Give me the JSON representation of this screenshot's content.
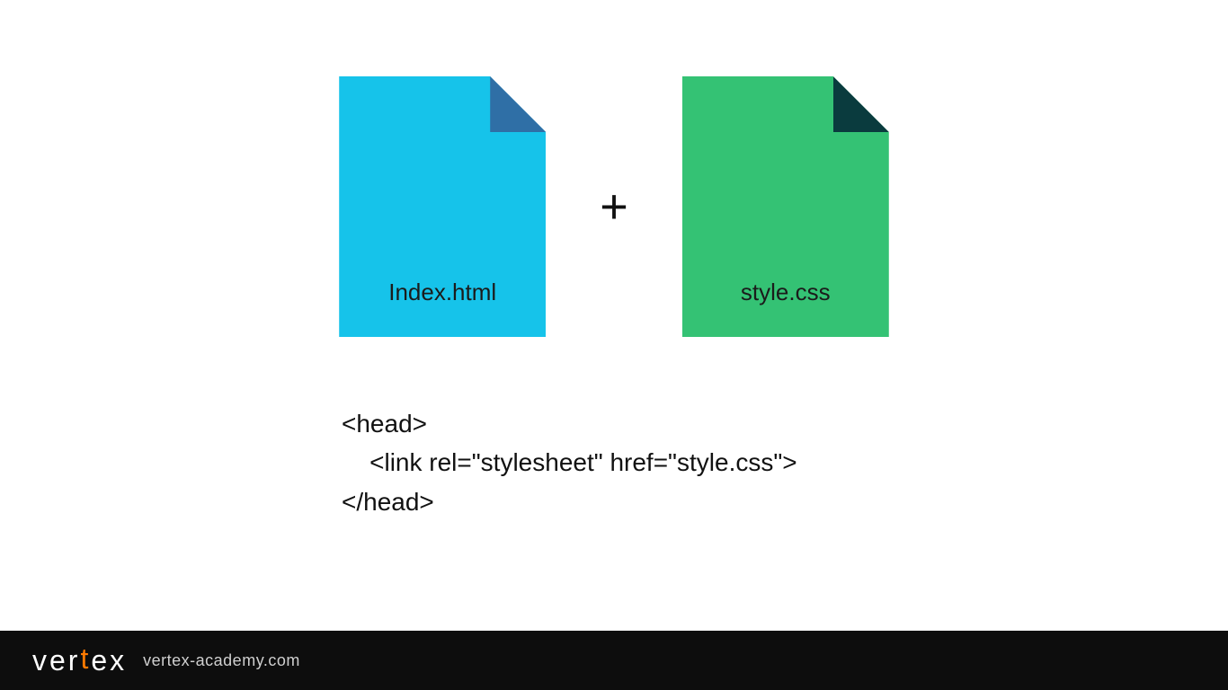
{
  "files": {
    "html": {
      "label": "Index.html"
    },
    "css": {
      "label": "style.css"
    }
  },
  "plus": "+",
  "code": {
    "line1": "<head>",
    "line2": "    <link rel=\"stylesheet\" href=\"style.css\">",
    "line3": "</head>"
  },
  "footer": {
    "brand_pre": "ver",
    "brand_accent": "t",
    "brand_post": "ex",
    "url": "vertex-academy.com"
  },
  "colors": {
    "html_body": "#16c3ea",
    "html_fold": "#2f6fa6",
    "css_body": "#34c274",
    "css_fold": "#0a3b3e",
    "accent": "#ff7a00",
    "footer_bg": "#0d0d0d"
  }
}
